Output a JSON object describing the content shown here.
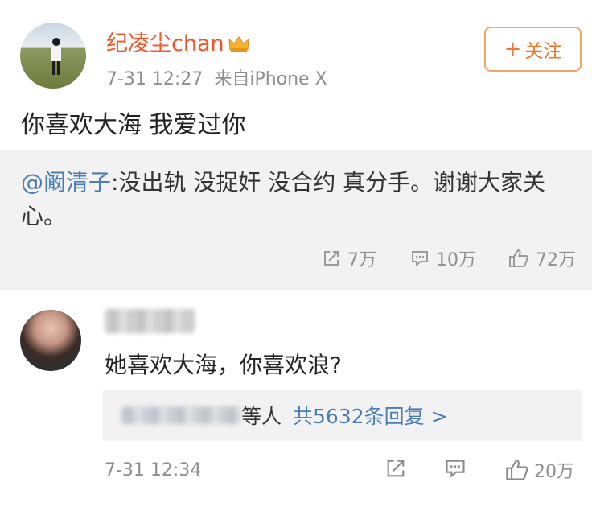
{
  "post": {
    "username": "纪凌尘chan",
    "time": "7-31 12:27",
    "source": "来自iPhone X",
    "follow_label": "关注",
    "text": "你喜欢大海 我爱过你"
  },
  "repost": {
    "mention": "@阚清子",
    "text": ":没出轨 没捉奸 没合约 真分手。谢谢大家关心。",
    "stats": {
      "shares": "7万",
      "comments": "10万",
      "likes": "72万"
    }
  },
  "comment": {
    "text": "她喜欢大海，你喜欢浪?",
    "replies_suffix": "等人",
    "replies_total": "共5632条回复 >",
    "time": "7-31 12:34",
    "likes": "20万"
  },
  "colors": {
    "accent": "#f0582a",
    "link": "#4a7cb5",
    "muted": "#8e8e8e"
  },
  "icons": [
    "crown-icon",
    "plus-icon",
    "share-icon",
    "comment-icon",
    "thumbs-up-icon"
  ]
}
